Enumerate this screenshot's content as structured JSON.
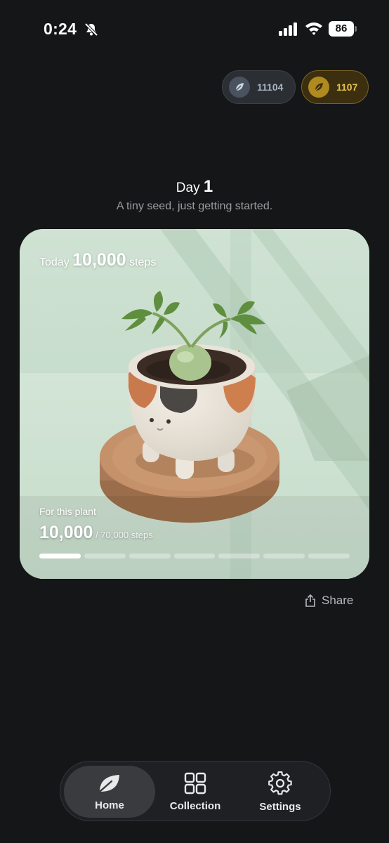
{
  "status_bar": {
    "time": "0:24",
    "battery": "86"
  },
  "currencies": [
    {
      "icon": "leaf-icon",
      "value": "11104"
    },
    {
      "icon": "gold-leaf-icon",
      "value": "1107"
    }
  ],
  "header": {
    "day_label": "Day",
    "day_number": "1",
    "subtitle": "A tiny seed, just getting started."
  },
  "card": {
    "today_prefix": "Today",
    "today_steps": "10,000",
    "today_suffix": "steps",
    "for_plant_label": "For this plant",
    "plant_steps": "10,000",
    "plant_goal": "/ 70,000 steps",
    "progress_segments_total": 7,
    "progress_segments_filled": 1
  },
  "share_label": "Share",
  "tabs": [
    {
      "label": "Home",
      "icon": "leaf-icon",
      "active": true
    },
    {
      "label": "Collection",
      "icon": "grid-icon",
      "active": false
    },
    {
      "label": "Settings",
      "icon": "gear-icon",
      "active": false
    }
  ],
  "colors": {
    "background": "#151618",
    "gold": "#e8c04a",
    "silver": "#a9b4c3"
  }
}
